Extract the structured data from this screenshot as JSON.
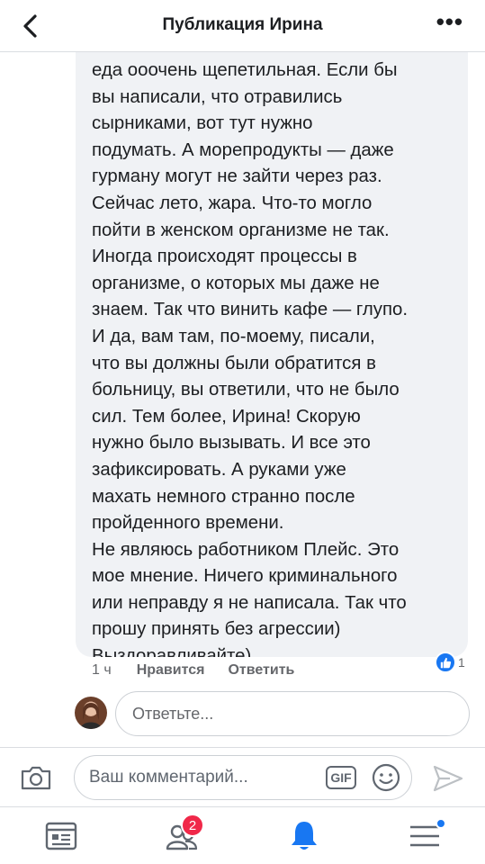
{
  "header": {
    "title": "Публикация Ирина",
    "more_label": "•••"
  },
  "comment": {
    "text": "еда ооочень щепетильная. Если бы\nвы написали, что отравились\nсырниками, вот тут нужно\nподумать. А морепродукты — даже\nгурману могут не зайти через раз.\nСейчас лето, жара. Что-то могло\nпойти в женском организме не так.\nИногда происходят процессы в\nорганизме, о которых мы даже не\nзнаем. Так что винить кафе — глупо.\nИ да, вам там, по-моему, писали,\nчто вы должны были обратится в\nбольницу, вы ответили, что не было\nсил. Тем более, Ирина! Скорую\nнужно было вызывать. И все это\nзафиксировать. А руками уже\nмахать немного странно после\nпройденного времени.\nНе являюсь работником Плейс. Это\nмое мнение. Ничего криминального\nили неправду я не написала. Так что\nпрошу принять без агрессии)\nВыздоравливайте)",
    "time": "1 ч",
    "like_label": "Нравится",
    "reply_label": "Ответить",
    "reaction_count": "1"
  },
  "reply": {
    "placeholder": "Ответьте..."
  },
  "composer": {
    "placeholder": "Ваш комментарий...",
    "gif_label": "GIF"
  },
  "nav": {
    "friends_badge": "2"
  },
  "colors": {
    "accent": "#1877f2",
    "badge": "#f02849",
    "bubble": "#f0f2f5"
  }
}
